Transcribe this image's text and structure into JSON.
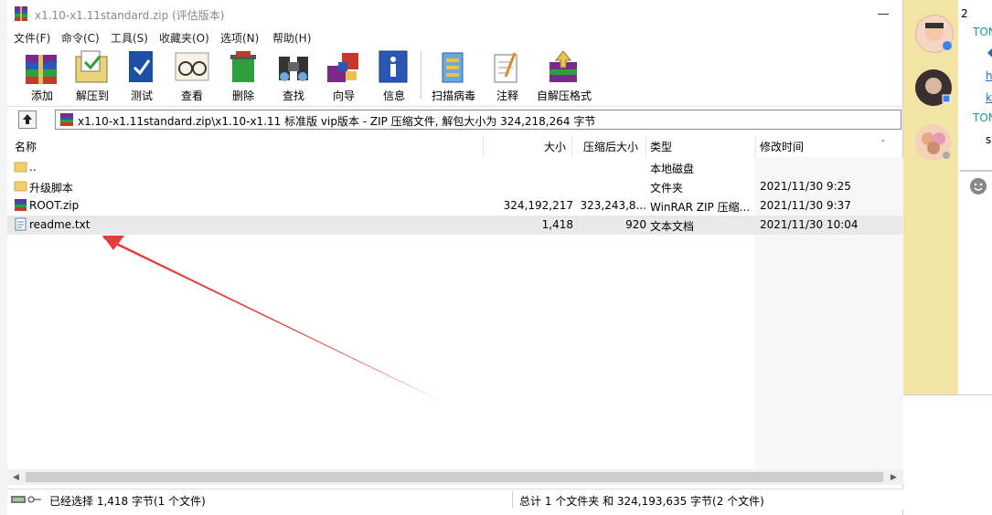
{
  "window": {
    "title": "x1.10-x1.11standard.zip (评估版本)"
  },
  "menu": [
    "文件(F)",
    "命令(C)",
    "工具(S)",
    "收藏夹(O)",
    "选项(N)",
    "帮助(H)"
  ],
  "toolbar": [
    "添加",
    "解压到",
    "测试",
    "查看",
    "删除",
    "查找",
    "向导",
    "信息",
    "扫描病毒",
    "注释",
    "自解压格式"
  ],
  "address": {
    "path": "x1.10-x1.11standard.zip\\x1.10-x1.11 标准版 vip版本 - ZIP 压缩文件, 解包大小为 324,218,264 字节"
  },
  "columns": {
    "name": "名称",
    "size": "大小",
    "packed": "压缩后大小",
    "type": "类型",
    "modified": "修改时间"
  },
  "files": [
    {
      "name": "..",
      "size": "",
      "packed": "",
      "type": "本地磁盘",
      "modified": "",
      "icon": "folder-icon"
    },
    {
      "name": "升级脚本",
      "size": "",
      "packed": "",
      "type": "文件夹",
      "modified": "2021/11/30 9:25",
      "icon": "folder-icon"
    },
    {
      "name": "ROOT.zip",
      "size": "324,192,217",
      "packed": "323,243,8...",
      "type": "WinRAR ZIP 压缩...",
      "modified": "2021/11/30 9:37",
      "icon": "zip-icon"
    },
    {
      "name": "readme.txt",
      "size": "1,418",
      "packed": "920",
      "type": "文本文档",
      "modified": "2021/11/30 10:04",
      "icon": "text-file-icon"
    }
  ],
  "status": {
    "selection": "已经选择 1,418 字节(1 个文件)",
    "total": "总计 1 个文件夹 和 324,193,635 字节(2 个文件)"
  },
  "chat": {
    "items": [
      "2",
      "TON",
      "h",
      "k",
      "TON",
      "s"
    ]
  },
  "colors": {
    "accent_chat_name": "#16a085",
    "annotation_arrow": "#e63b3b",
    "chat_panel": "#f1e4a4"
  }
}
